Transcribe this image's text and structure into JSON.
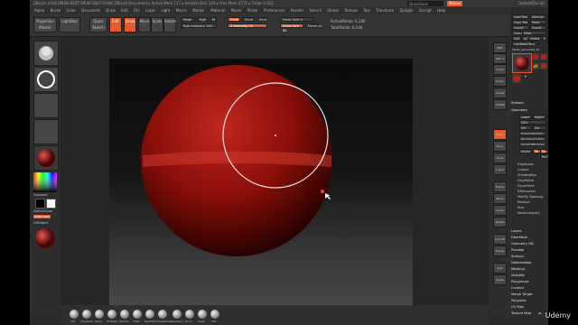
{
  "app": {
    "title": "ZBrush 2018 [8KAE-HEZT-SPLW-5SH7-5AAK] ZBrush Document ▸ Active Mem 117 ▸ Scratch Disk 126 ▸ Free Mem 3775 ▸ Timer 0.022",
    "quicksave": "QuickSave",
    "see_through": "See-through 0",
    "menus": "Menus",
    "default_script": "DefaultZScript"
  },
  "menu_items": [
    "Alpha",
    "Brush",
    "Color",
    "Document",
    "Draw",
    "Edit",
    "File",
    "Layer",
    "Light",
    "Macro",
    "Marker",
    "Material",
    "Movie",
    "Picker",
    "Preferences",
    "Render",
    "Stencil",
    "Stroke",
    "Texture",
    "Tool",
    "Transform",
    "Zplugin",
    "Zscript",
    "Help"
  ],
  "shelf": {
    "projection": "Projection Master",
    "lightbox": "LightBox",
    "quick_sketch": "Quick Sketch",
    "edit": "Edit",
    "draw": "Draw",
    "move": "Move",
    "scale": "Scale",
    "rotate": "Rotate",
    "mrgb": "Mrgb",
    "rgb": "Rgb",
    "m": "M",
    "zadd": "Zadd",
    "zsub": "Zsub",
    "zcut": "Zcut",
    "rgb_intensity": "Rgb Intensity 100",
    "z_intensity": "Z Intensity 25",
    "focal_shift": "Focal Shift 0",
    "draw_size": "Draw Size 64",
    "dynamic": "Dynamic",
    "active_points": "ActivePoints: 6,146",
    "total_points": "TotalPoints: 6,146"
  },
  "left_panel": {
    "gradient": "Gradient",
    "switch_color": "SwitchColor",
    "alternate": "Alternate",
    "fill_object": "FillObject"
  },
  "right_icons": [
    "BPR",
    "SPix 3",
    "Scroll",
    "Zoom",
    "Actual",
    "AAHalf",
    "Persp",
    "Floor",
    "Local",
    "L.Sym",
    "Frame",
    "Move",
    "Scale",
    "Rotate",
    "Line Fill",
    "Transp",
    "Solo",
    "Xpose"
  ],
  "tray": {
    "load_tool": "Load Tool",
    "save_as": "Save As",
    "copy_tool": "Copy Tool",
    "paste_tool": "Paste Tool",
    "import": "Import",
    "export": "Export",
    "clone": "Clone",
    "make_polymesh": "Make PolyMesh3D",
    "goz": "GoZ",
    "all": "All",
    "visible": "Visible",
    "r": "R",
    "lightbox_tools": "Lightbox▸Tools",
    "tool_name": "PM3D_Sphere3D_48",
    "r2": "R",
    "subtool": "Subtool",
    "geometry": "Geometry",
    "lower_res": "Lower Res",
    "higher_res": "Higher Res",
    "sdiv": "SDiv",
    "del_lower": "Del Lower",
    "del_higher": "Del Higher",
    "freeze_subdiv": "Freeze SubDivision Levels",
    "reconstruct": "Reconstruct Subdiv",
    "convert_bpr": "Convert BPR To Geo",
    "divide": "Divide",
    "smt": "Smt",
    "suv": "Suv",
    "rsuv": "ReUV",
    "edgeloop": "EdgeLoop",
    "crease": "Crease",
    "shadowbox": "ShadowBox",
    "claypolish": "ClayPolish",
    "dynamesh": "DynaMesh",
    "zremesher": "ZRemesher",
    "modify_topology": "Modify Topology",
    "position": "Position",
    "size": "Size",
    "meshintegrity": "MeshIntegrity",
    "sections": [
      "Layers",
      "FiberMesh",
      "Geometry HD",
      "Preview",
      "Surface",
      "Deformation",
      "Masking",
      "Visibility",
      "Polygroups",
      "Contact",
      "Morph Target",
      "Polypaint",
      "UV Map",
      "Texture Map"
    ]
  },
  "bottom_brushes": [
    "Std",
    "ClayBuild",
    "Move",
    "TrimDyn",
    "hPolish",
    "Inflat",
    "DamStd",
    "SnakeHook",
    "Standard",
    "Pinch",
    "Slash",
    "Flat"
  ],
  "watermark": "Udemy",
  "colors": {
    "accent": "#e8582a",
    "bg": "#2a2a2a",
    "sphere": "#a8120c"
  }
}
